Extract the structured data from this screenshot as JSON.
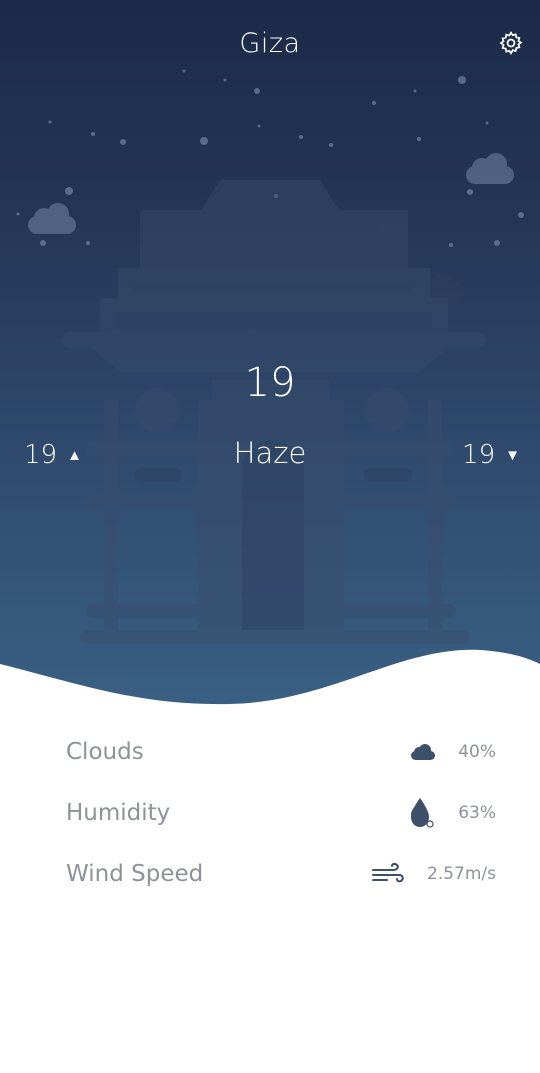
{
  "header": {
    "city": "Giza",
    "settings_icon": "gear-icon"
  },
  "current": {
    "temperature": "19",
    "condition": "Haze",
    "min_temp": "19",
    "max_temp": "19",
    "min_arrow": "▲",
    "max_arrow": "▼"
  },
  "details": [
    {
      "label": "Clouds",
      "value": "40%",
      "icon": "cloud-icon"
    },
    {
      "label": "Humidity",
      "value": "63%",
      "icon": "water-drop-icon"
    },
    {
      "label": "Wind Speed",
      "value": "2.57m/s",
      "icon": "wind-icon"
    }
  ],
  "colors": {
    "sky_top": "#1c2a49",
    "sky_bottom": "#3a6184",
    "detail_text": "#8e9299",
    "icon_dark": "#3e4f6a"
  }
}
